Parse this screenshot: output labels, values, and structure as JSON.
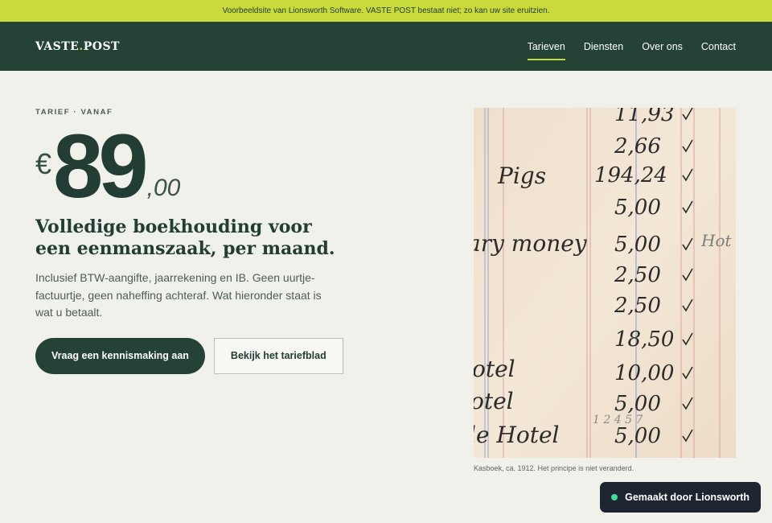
{
  "banner": {
    "text": "Voorbeeldsite van Lionsworth Software. VASTE POST bestaat niet; zo kan uw site eruitzien."
  },
  "nav": {
    "logo_main": "VASTE",
    "logo_dot": ".",
    "logo_end": "POST",
    "links": [
      "Tarieven",
      "Diensten",
      "Over ons",
      "Contact"
    ],
    "active": "Tarieven"
  },
  "hero": {
    "eyebrow": "TARIEF · VANAF",
    "currency": "€",
    "amount": "89",
    "cents": ",00",
    "headline": "Volledige boekhouding voor een eenmanszaak, per maand.",
    "description": "Inclusief BTW-aangifte, jaarrekening en IB. Geen uurtje-factuurtje, geen naheffing achteraf. Wat hieronder staat is wat u betaalt.",
    "primary_button": "Vraag een kennismaking aan",
    "secondary_button": "Bekijk het tariefblad"
  },
  "figure": {
    "caption": "Kasboek, ca. 1912. Het principe is niet veranderd.",
    "ledger_amounts": [
      "11,93",
      "2,66",
      "194,24",
      "5,00",
      "5,00",
      "2,50",
      "2,50",
      "18,50",
      "10,00",
      "5,00",
      "5,00"
    ],
    "ledger_words": [
      "Pigs",
      "ary money",
      "otel",
      "otel",
      "le Hotel"
    ]
  },
  "badge": {
    "text": "Gemaakt door Lionsworth"
  },
  "colors": {
    "accent": "#c9db3a",
    "dark": "#244236",
    "background": "#f1f1ec",
    "badge_dot": "#3ddc97"
  }
}
